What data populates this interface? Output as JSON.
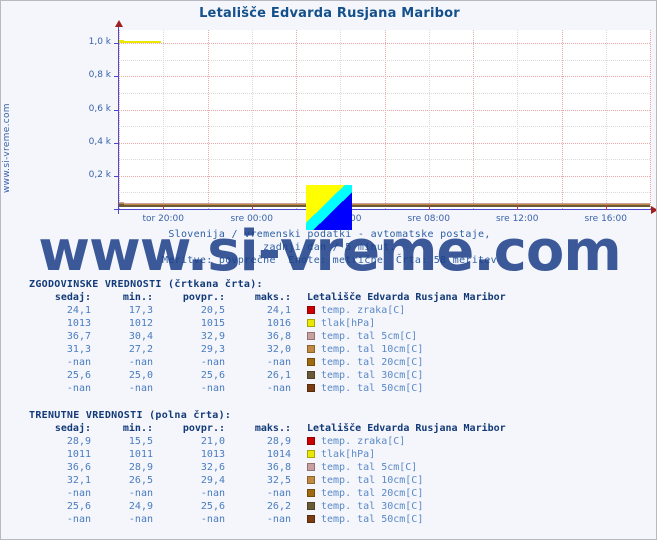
{
  "page": {
    "site_vertical_text": "www.si-vreme.com",
    "watermark": "www.si-vreme.com",
    "background": "#f4f6fb",
    "title_color": "#13508c"
  },
  "chart": {
    "title": "Letališče Edvarda Rusjana Maribor",
    "subtitle_line1": "Slovenija / vremenski podatki - avtomatske postaje,",
    "subtitle_line2": "zadnji dan / 5 minut.",
    "subtitle_line3": "Meritve: povprečne  Enote: metrične  Črta: 58 meritev"
  },
  "chart_data": {
    "type": "line",
    "title": "Letališče Edvarda Rusjana Maribor",
    "xlabel": "",
    "ylabel": "",
    "ylim": [
      0,
      1080
    ],
    "yticks": [
      200,
      400,
      600,
      800,
      1000
    ],
    "ytick_labels": [
      "0,2 k",
      "0,4 k",
      "0,6 k",
      "0,8 k",
      "1,0 k"
    ],
    "xtick_labels": [
      "tor 20:00",
      "sre 00:00",
      "sre 04:00",
      "sre 08:00",
      "sre 12:00",
      "sre 16:00"
    ],
    "grid": true,
    "legend_position": "below-right",
    "series": [
      {
        "name": "temp. zraka[C]",
        "color": "#cc0000",
        "style": "solid",
        "value": 28.9,
        "hist_value": 24.1
      },
      {
        "name": "tlak[hPa]",
        "color": "#e8e800",
        "style": "solid",
        "value": 1011,
        "hist_value": 1013
      },
      {
        "name": "temp. tal  5cm[C]",
        "color": "#c9a0a0",
        "style": "solid",
        "value": 36.6,
        "hist_value": 36.7
      },
      {
        "name": "temp. tal 10cm[C]",
        "color": "#c28a40",
        "style": "solid",
        "value": 32.1,
        "hist_value": 31.3
      },
      {
        "name": "temp. tal 20cm[C]",
        "color": "#a06a10",
        "style": "solid",
        "value": null,
        "hist_value": null
      },
      {
        "name": "temp. tal 30cm[C]",
        "color": "#6b5a38",
        "style": "solid",
        "value": 25.6,
        "hist_value": 25.6
      },
      {
        "name": "temp. tal 50cm[C]",
        "color": "#7a3c10",
        "style": "solid",
        "value": null,
        "hist_value": null
      }
    ]
  },
  "historical": {
    "title": "ZGODOVINSKE VREDNOSTI (črtkana črta):",
    "headers": {
      "sedaj": "sedaj:",
      "min": "min.:",
      "povpr": "povpr.:",
      "maks": "maks.:",
      "station": "Letališče Edvarda Rusjana Maribor"
    },
    "rows": [
      {
        "sedaj": "24,1",
        "min": "17,3",
        "povpr": "20,5",
        "maks": "24,1",
        "color": "#cc0000",
        "label": "temp. zraka[C]"
      },
      {
        "sedaj": "1013",
        "min": "1012",
        "povpr": "1015",
        "maks": "1016",
        "color": "#e8e800",
        "label": "tlak[hPa]"
      },
      {
        "sedaj": "36,7",
        "min": "30,4",
        "povpr": "32,9",
        "maks": "36,8",
        "color": "#c9a0a0",
        "label": "temp. tal  5cm[C]"
      },
      {
        "sedaj": "31,3",
        "min": "27,2",
        "povpr": "29,3",
        "maks": "32,0",
        "color": "#c28a40",
        "label": "temp. tal 10cm[C]"
      },
      {
        "sedaj": "-nan",
        "min": "-nan",
        "povpr": "-nan",
        "maks": "-nan",
        "color": "#a06a10",
        "label": "temp. tal 20cm[C]"
      },
      {
        "sedaj": "25,6",
        "min": "25,0",
        "povpr": "25,6",
        "maks": "26,1",
        "color": "#6b5a38",
        "label": "temp. tal 30cm[C]"
      },
      {
        "sedaj": "-nan",
        "min": "-nan",
        "povpr": "-nan",
        "maks": "-nan",
        "color": "#7a3c10",
        "label": "temp. tal 50cm[C]"
      }
    ]
  },
  "current": {
    "title": "TRENUTNE VREDNOSTI (polna črta):",
    "headers": {
      "sedaj": "sedaj:",
      "min": "min.:",
      "povpr": "povpr.:",
      "maks": "maks.:",
      "station": "Letališče Edvarda Rusjana Maribor"
    },
    "rows": [
      {
        "sedaj": "28,9",
        "min": "15,5",
        "povpr": "21,0",
        "maks": "28,9",
        "color": "#cc0000",
        "label": "temp. zraka[C]"
      },
      {
        "sedaj": "1011",
        "min": "1011",
        "povpr": "1013",
        "maks": "1014",
        "color": "#e8e800",
        "label": "tlak[hPa]"
      },
      {
        "sedaj": "36,6",
        "min": "28,9",
        "povpr": "32,6",
        "maks": "36,8",
        "color": "#c9a0a0",
        "label": "temp. tal  5cm[C]"
      },
      {
        "sedaj": "32,1",
        "min": "26,5",
        "povpr": "29,4",
        "maks": "32,5",
        "color": "#c28a40",
        "label": "temp. tal 10cm[C]"
      },
      {
        "sedaj": "-nan",
        "min": "-nan",
        "povpr": "-nan",
        "maks": "-nan",
        "color": "#a06a10",
        "label": "temp. tal 20cm[C]"
      },
      {
        "sedaj": "25,6",
        "min": "24,9",
        "povpr": "25,6",
        "maks": "26,2",
        "color": "#6b5a38",
        "label": "temp. tal 30cm[C]"
      },
      {
        "sedaj": "-nan",
        "min": "-nan",
        "povpr": "-nan",
        "maks": "-nan",
        "color": "#7a3c10",
        "label": "temp. tal 50cm[C]"
      }
    ]
  }
}
